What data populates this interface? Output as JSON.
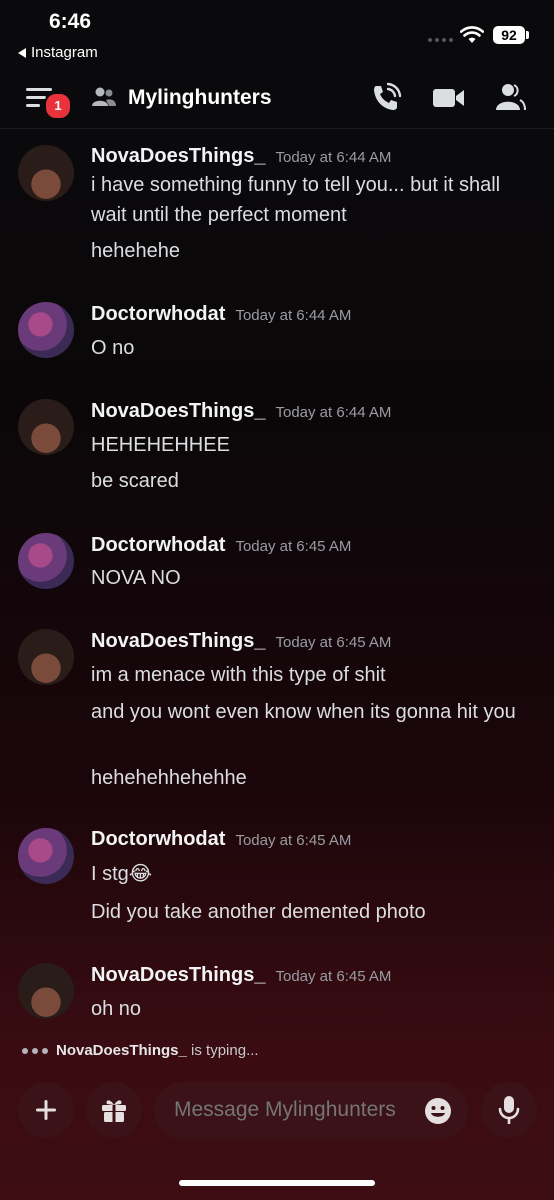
{
  "status": {
    "time": "6:46",
    "back_app": "Instagram",
    "battery": "92"
  },
  "header": {
    "title": "Mylinghunters",
    "notification_count": "1"
  },
  "messages": [
    {
      "user": "NovaDoesThings_",
      "time": "Today at 6:44 AM",
      "lines": [
        "i have something funny to tell you... but it shall wait until the perfect moment",
        "hehehehe"
      ]
    },
    {
      "user": "Doctorwhodat",
      "time": "Today at 6:44 AM",
      "lines": [
        "O no"
      ]
    },
    {
      "user": "NovaDoesThings_",
      "time": "Today at 6:44 AM",
      "lines": [
        "HEHEHEHHEE",
        "be scared"
      ]
    },
    {
      "user": "Doctorwhodat",
      "time": "Today at 6:45 AM",
      "lines": [
        "NOVA NO"
      ]
    },
    {
      "user": "NovaDoesThings_",
      "time": "Today at 6:45 AM",
      "lines": [
        "im a menace with this type of shit",
        "and you wont even know when its gonna hit you",
        "hehehehhehehhe"
      ]
    },
    {
      "user": "Doctorwhodat",
      "time": "Today at 6:45 AM",
      "lines": [
        "I stg😂",
        "Did you take another demented photo"
      ]
    },
    {
      "user": "NovaDoesThings_",
      "time": "Today at 6:45 AM",
      "lines": [
        "oh no"
      ]
    }
  ],
  "typing": {
    "user": "NovaDoesThings_",
    "suffix": "is typing..."
  },
  "composer": {
    "placeholder": "Message Mylinghunters"
  },
  "icons": [
    "menu-icon",
    "group-icon",
    "call-icon",
    "video-icon",
    "members-icon",
    "plus-icon",
    "gift-icon",
    "emoji-icon",
    "microphone-icon"
  ],
  "colors": {
    "badge": "#e8323c",
    "composer_bg": "#3a1218"
  }
}
